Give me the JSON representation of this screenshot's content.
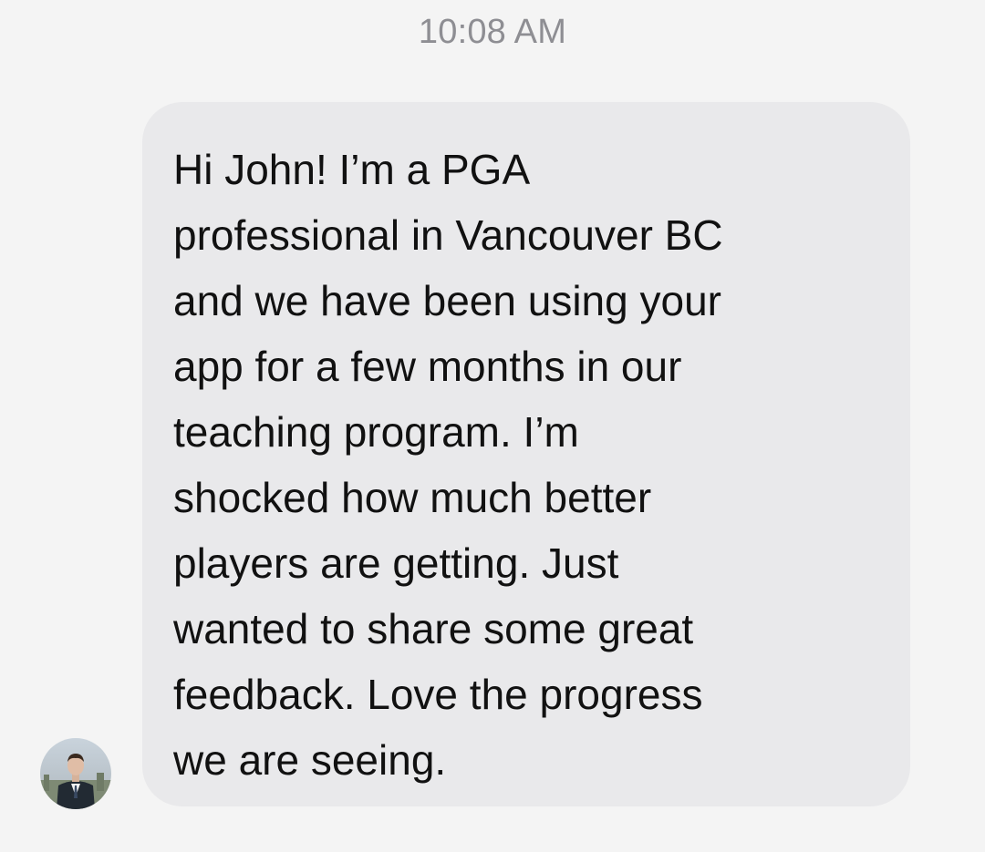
{
  "thread": {
    "timestamp": "10:08 AM"
  },
  "message": {
    "lines": [
      "Hi John! I’m a PGA",
      "professional in Vancouver BC",
      "and we have been using your",
      "app for a few months in our",
      "teaching program. I’m",
      "shocked how much better",
      "players are getting. Just",
      "wanted to share some great",
      "feedback. Love the progress",
      "we are seeing."
    ]
  },
  "sender": {
    "avatar_icon": "person-avatar-photo"
  },
  "colors": {
    "background": "#f4f4f4",
    "bubble": "#e9e9eb",
    "text": "#111111",
    "timestamp": "#8e8e93"
  }
}
